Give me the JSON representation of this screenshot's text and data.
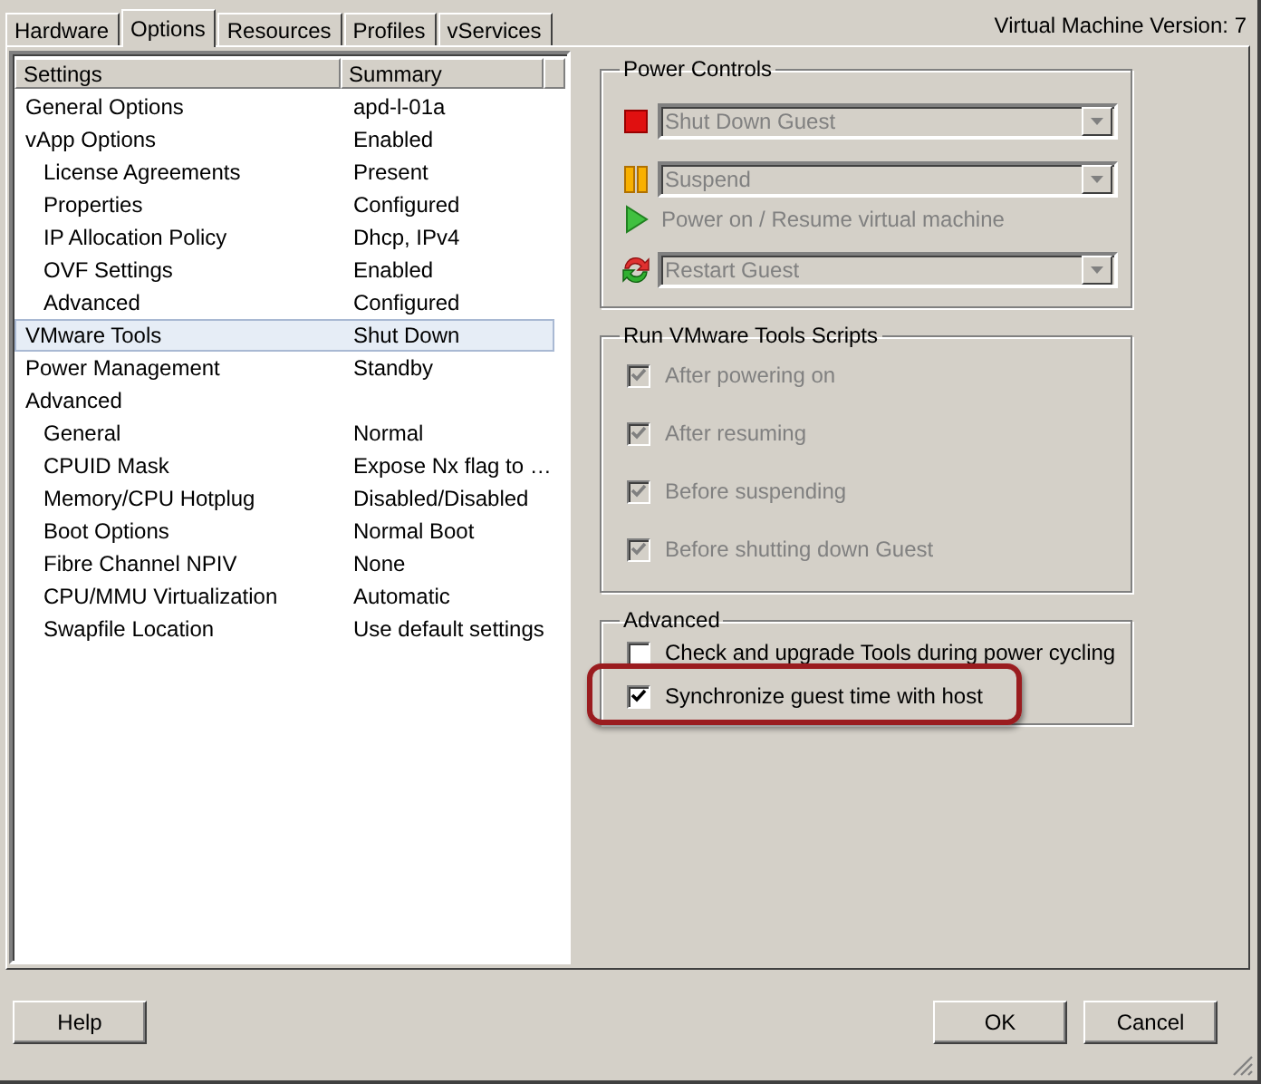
{
  "tabs": [
    {
      "label": "Hardware",
      "selected": false
    },
    {
      "label": "Options",
      "selected": true
    },
    {
      "label": "Resources",
      "selected": false
    },
    {
      "label": "Profiles",
      "selected": false
    },
    {
      "label": "vServices",
      "selected": false
    }
  ],
  "version_label": "Virtual Machine Version: 7",
  "settings_table": {
    "columns": [
      "Settings",
      "Summary"
    ],
    "rows": [
      {
        "setting": "General Options",
        "summary": "apd-l-01a",
        "selected": false
      },
      {
        "setting": "vApp Options",
        "summary": "Enabled",
        "selected": false,
        "children": [
          {
            "setting": "License Agreements",
            "summary": "Present",
            "selected": false
          },
          {
            "setting": "Properties",
            "summary": "Configured",
            "selected": false
          },
          {
            "setting": "IP Allocation Policy",
            "summary": "Dhcp, IPv4",
            "selected": false
          },
          {
            "setting": "OVF Settings",
            "summary": "Enabled",
            "selected": false
          },
          {
            "setting": "Advanced",
            "summary": "Configured",
            "selected": false
          }
        ]
      },
      {
        "setting": "VMware Tools",
        "summary": "Shut Down",
        "selected": true
      },
      {
        "setting": "Power Management",
        "summary": "Standby",
        "selected": false
      },
      {
        "setting": "Advanced",
        "selected": false,
        "children": [
          {
            "setting": "General",
            "summary": "Normal",
            "selected": false
          },
          {
            "setting": "CPUID Mask",
            "summary": "Expose Nx flag to …",
            "selected": false
          },
          {
            "setting": "Memory/CPU Hotplug",
            "summary": "Disabled/Disabled",
            "selected": false
          },
          {
            "setting": "Boot Options",
            "summary": "Normal Boot",
            "selected": false
          },
          {
            "setting": "Fibre Channel NPIV",
            "summary": "None",
            "selected": false
          },
          {
            "setting": "CPU/MMU Virtualization",
            "summary": "Automatic",
            "selected": false
          },
          {
            "setting": "Swapfile Location",
            "summary": "Use default settings",
            "selected": false
          }
        ]
      }
    ]
  },
  "power_controls": {
    "title": "Power Controls",
    "items": [
      {
        "kind": "dropdown",
        "value": "Shut Down Guest",
        "disabled": true
      },
      {
        "kind": "dropdown",
        "value": "Suspend",
        "disabled": true
      },
      {
        "kind": "text",
        "value": "Power on / Resume virtual machine",
        "disabled": true
      },
      {
        "kind": "dropdown",
        "value": "Restart Guest",
        "disabled": true
      }
    ]
  },
  "scripts": {
    "title": "Run VMware Tools Scripts",
    "options": [
      {
        "label": "After powering on",
        "checked": true,
        "disabled": true
      },
      {
        "label": "After resuming",
        "checked": true,
        "disabled": true
      },
      {
        "label": "Before suspending",
        "checked": true,
        "disabled": true
      },
      {
        "label": "Before shutting down Guest",
        "checked": true,
        "disabled": true
      }
    ]
  },
  "advanced": {
    "title": "Advanced",
    "options": [
      {
        "label": "Check and upgrade Tools during power cycling",
        "checked": false,
        "disabled": false,
        "highlighted": false
      },
      {
        "label": "Synchronize guest time with host",
        "checked": true,
        "disabled": false,
        "highlighted": true
      }
    ]
  },
  "left_buttons": [
    "Help"
  ],
  "right_buttons": [
    "OK",
    "Cancel"
  ]
}
